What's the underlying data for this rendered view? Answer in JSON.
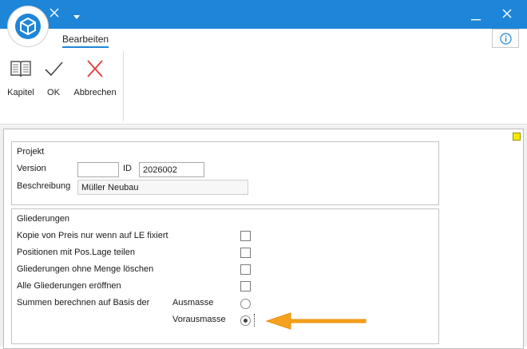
{
  "ribbon_tabs": [
    "Bearbeiten"
  ],
  "ribbon_buttons": {
    "kapitel": "Kapitel",
    "ok": "OK",
    "abbrechen": "Abbrechen"
  },
  "projekt": {
    "title": "Projekt",
    "version_label": "Version",
    "version_value": "",
    "id_label": "ID",
    "id_value": "2026002",
    "beschreibung_label": "Beschreibung",
    "beschreibung_value": "Müller Neubau"
  },
  "gliederungen": {
    "title": "Gliederungen",
    "options": [
      {
        "label": "Kopie von Preis nur wenn auf LE fixiert",
        "checked": false
      },
      {
        "label": "Positionen mit Pos.Lage teilen",
        "checked": false
      },
      {
        "label": "Gliederungen ohne Menge löschen",
        "checked": false
      },
      {
        "label": "Alle Gliederungen eröffnen",
        "checked": false
      }
    ],
    "summen_label": "Summen berechnen auf Basis der",
    "radio_options": [
      "Ausmasse",
      "Vorausmasse"
    ],
    "radio_selected": "Vorausmasse"
  },
  "colors": {
    "titlebar": "#1e86d8",
    "highlight_arrow": "#f4a11d",
    "marker": "#f5e900"
  }
}
